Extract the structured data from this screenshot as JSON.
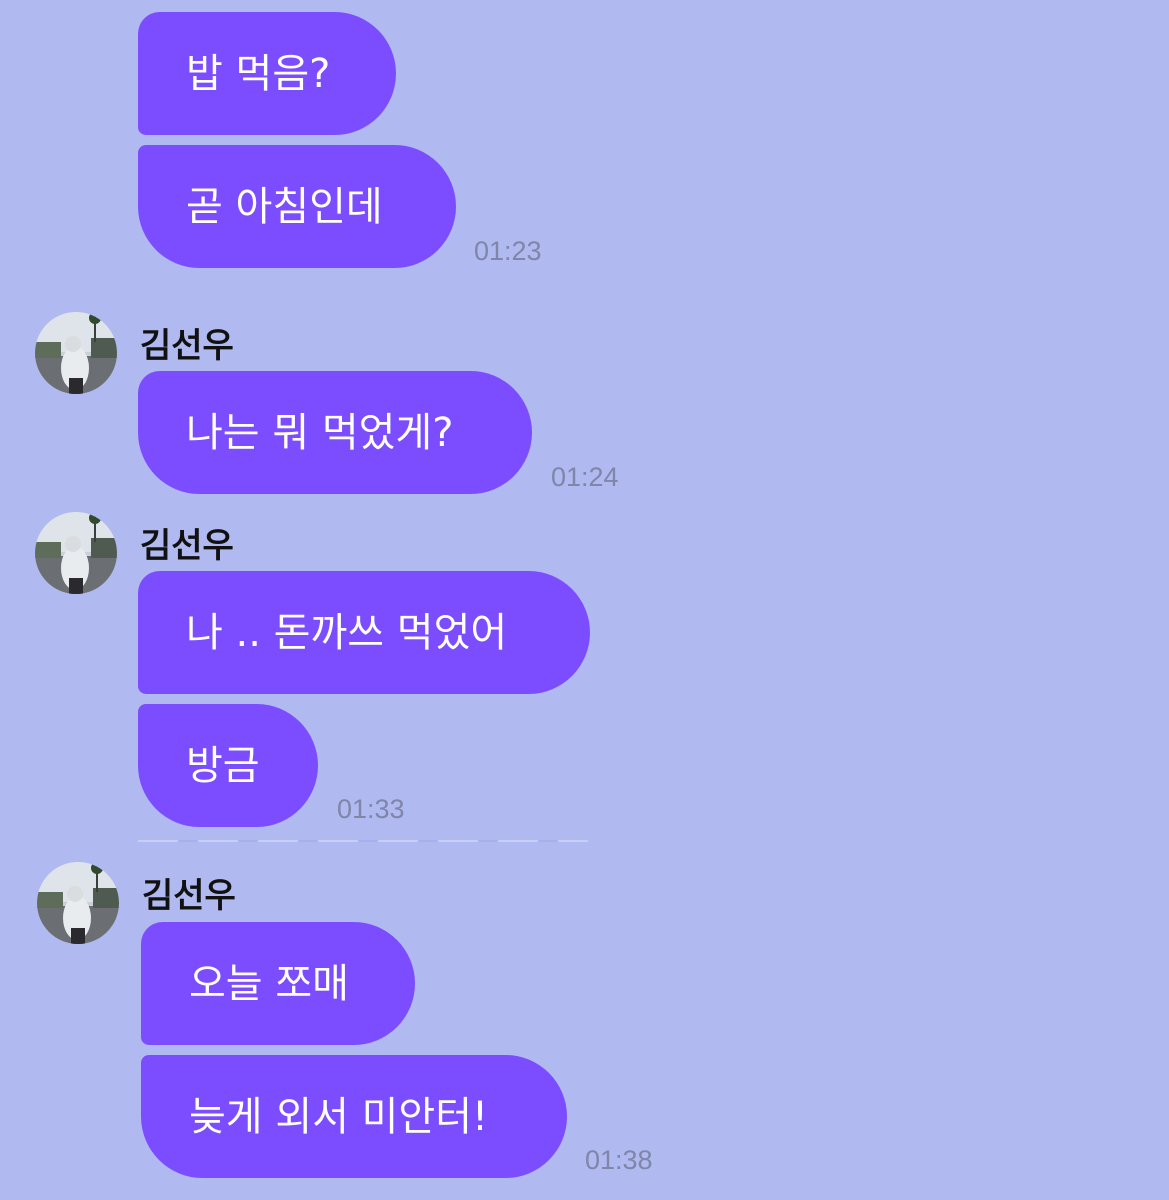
{
  "groups": [
    {
      "sender": null,
      "messages": [
        "밥 먹음?",
        "곧 아침인데"
      ],
      "time": "01:23"
    },
    {
      "sender": "김선우",
      "messages": [
        "나는 뭐 먹었게?"
      ],
      "time": "01:24"
    },
    {
      "sender": "김선우",
      "messages": [
        "나 .. 돈까쓰 먹었어",
        "방금"
      ],
      "time": "01:33"
    },
    {
      "sender": "김선우",
      "messages": [
        "오늘 쪼매",
        "늦게 외서 미안터!"
      ],
      "time": "01:38"
    }
  ],
  "colors": {
    "background": "#b0b9f0",
    "bubble": "#7c4dff",
    "bubble_text": "#ffffff",
    "timestamp": "#7f86a8",
    "sender_name": "#111111"
  },
  "icons": {
    "avatar": "profile-photo-avatar"
  }
}
